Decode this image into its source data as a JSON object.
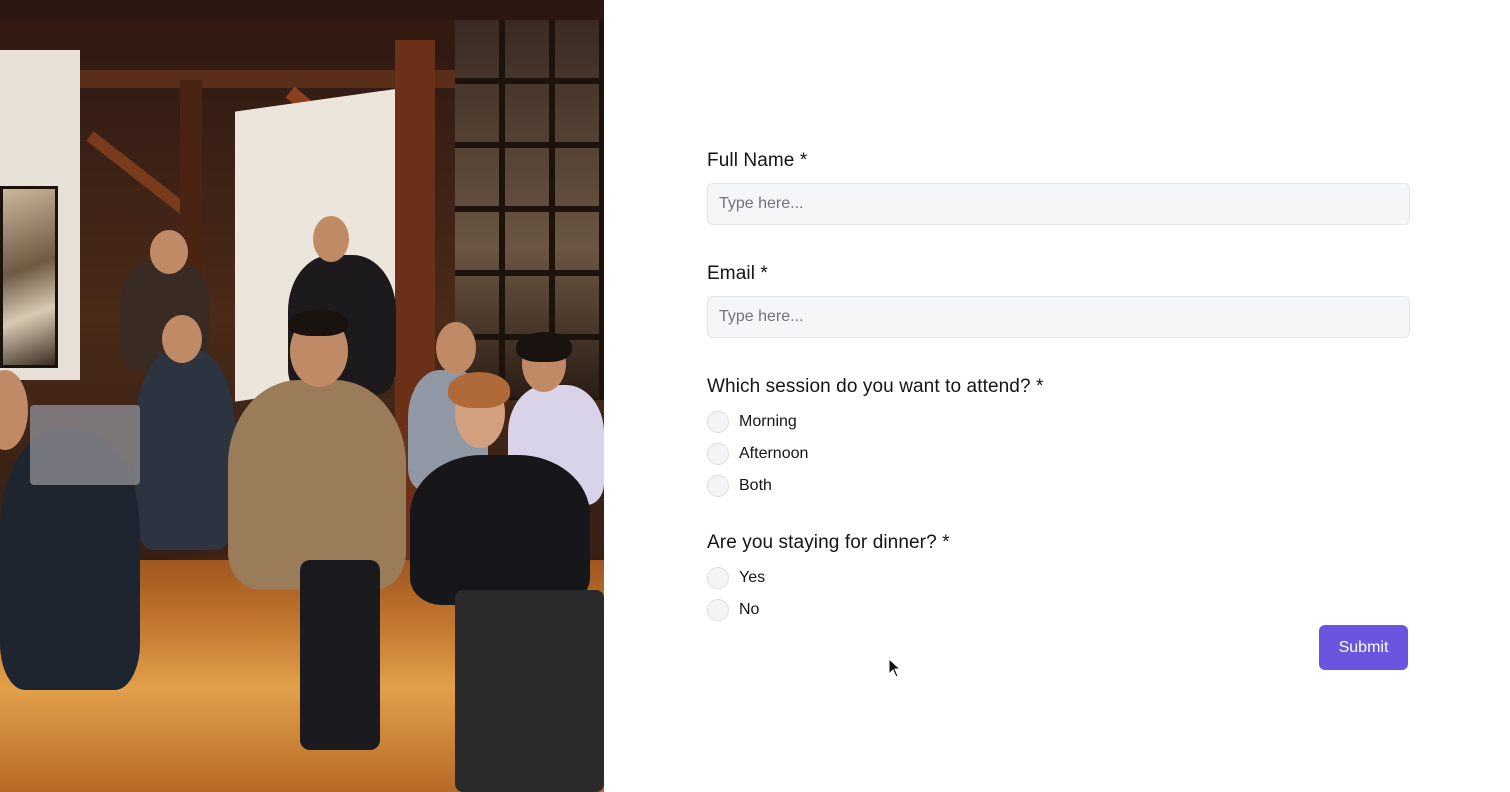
{
  "form": {
    "full_name": {
      "label": "Full Name *",
      "placeholder": "Type here...",
      "value": ""
    },
    "email": {
      "label": "Email *",
      "placeholder": "Type here...",
      "value": ""
    },
    "session": {
      "label": "Which session do you want to attend? *",
      "options": [
        "Morning",
        "Afternoon",
        "Both"
      ],
      "selected": null
    },
    "dinner": {
      "label": "Are you staying for dinner? *",
      "options": [
        "Yes",
        "No"
      ],
      "selected": null
    },
    "submit_label": "Submit"
  },
  "colors": {
    "accent": "#6a55e0",
    "input_bg": "#f5f6f8",
    "input_border": "#e3e5e8",
    "text": "#141414"
  },
  "icons": {
    "cursor": "mouse-pointer-icon"
  }
}
